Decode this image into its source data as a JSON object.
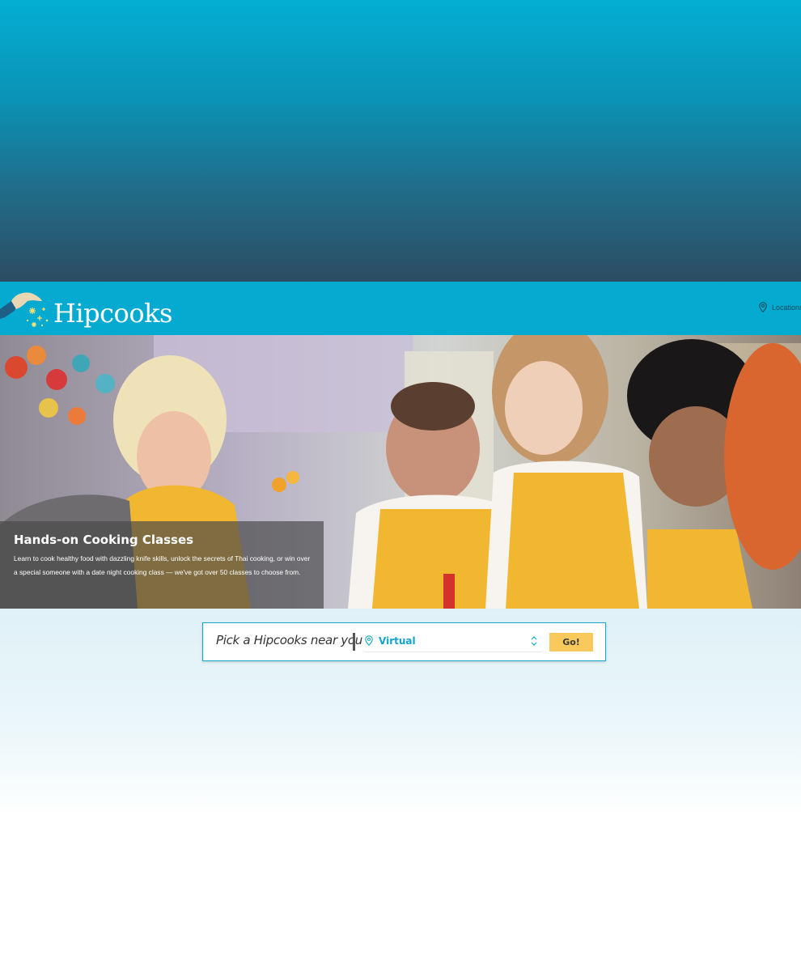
{
  "header": {
    "logo_text": "Hipcooks",
    "nav": {
      "locations_label": "Locations"
    }
  },
  "hero": {
    "title": "Hands-on Cooking Classes",
    "text": "Learn to cook healthy food with dazzling knife skills, unlock the secrets of Thai cooking, or win over a special someone with a date night cooking class — we've got over 50 classes to choose from."
  },
  "search": {
    "label": "Pick a Hipcooks near you",
    "selected_location": "Virtual",
    "go_label": "Go!"
  },
  "icons": {
    "location_pin": "map-pin-icon",
    "select_chevron": "chevron-up-down-icon"
  },
  "colors": {
    "brand_blue": "#05aad1",
    "accent_yellow": "#f9c95c",
    "link_blue": "#13a3c4",
    "apron_yellow": "#f2b731"
  }
}
